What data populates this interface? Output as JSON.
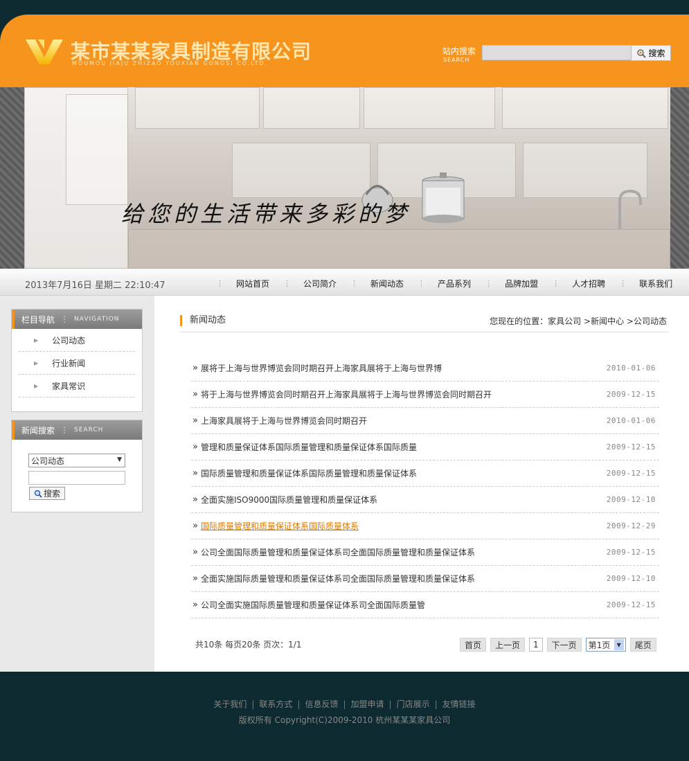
{
  "header": {
    "company_name": "某市某某家具制造有限公司",
    "company_name_en": "MOUMOU JIAJU ZHIZAO YOUXIAN GONGSI CO.LTD.",
    "search_label": "站内搜索",
    "search_label_en": "SEARCH",
    "search_value": "",
    "search_button": "搜索",
    "brand_color": "#f7941d"
  },
  "banner": {
    "slogan": "给您的生活带来多彩的梦"
  },
  "navbar": {
    "datetime": "2013年7月16日 星期二 22:10:47",
    "items": [
      "网站首页",
      "公司简介",
      "新闻动态",
      "产品系列",
      "品牌加盟",
      "人才招聘",
      "联系我们"
    ]
  },
  "sidebar": {
    "nav_title": "栏目导航",
    "nav_title_en": "NAVIGATION",
    "categories": [
      "公司动态",
      "行业新闻",
      "家具常识"
    ],
    "search_title": "新闻搜索",
    "search_title_en": "SEARCH",
    "search_select": "公司动态",
    "search_keyword": "",
    "search_button": "搜索"
  },
  "content": {
    "title": "新闻动态",
    "breadcrumb": {
      "prefix": "您现在的位置：",
      "items": [
        "家具公司",
        "新闻中心",
        "公司动态"
      ]
    },
    "news": [
      {
        "title": "展将于上海与世界博览会同时期召开上海家具展将于上海与世界博",
        "date": "2010-01-06"
      },
      {
        "title": "将于上海与世界博览会同时期召开上海家具展将于上海与世界博览会同时期召开",
        "date": "2009-12-15"
      },
      {
        "title": "上海家具展将于上海与世界博览会同时期召开",
        "date": "2010-01-06"
      },
      {
        "title": "管理和质量保证体系国际质量管理和质量保证体系国际质量",
        "date": "2009-12-15"
      },
      {
        "title": "国际质量管理和质量保证体系国际质量管理和质量保证体系",
        "date": "2009-12-15"
      },
      {
        "title": "全面实施ISO9000国际质量管理和质量保证体系",
        "date": "2009-12-10"
      },
      {
        "title": "国际质量管理和质量保证体系国际质量体系",
        "date": "2009-12-29"
      },
      {
        "title": "公司全面国际质量管理和质量保证体系司全面国际质量管理和质量保证体系",
        "date": "2009-12-15"
      },
      {
        "title": "全面实施国际质量管理和质量保证体系司全面国际质量管理和质量保证体系",
        "date": "2009-12-10"
      },
      {
        "title": "公司全面实施国际质量管理和质量保证体系司全面国际质量管",
        "date": "2009-12-15"
      }
    ],
    "pager": {
      "info": "共10条  每页20条  页次：1/1",
      "first": "首页",
      "prev": "上一页",
      "current": "1",
      "next": "下一页",
      "select": "第1页",
      "last": "尾页"
    }
  },
  "footer": {
    "links": [
      "关于我们",
      "联系方式",
      "信息反馈",
      "加盟申请",
      "门店展示",
      "友情链接"
    ],
    "copyright": "版权所有  Copyright(C)2009-2010 杭州某某某家具公司"
  }
}
